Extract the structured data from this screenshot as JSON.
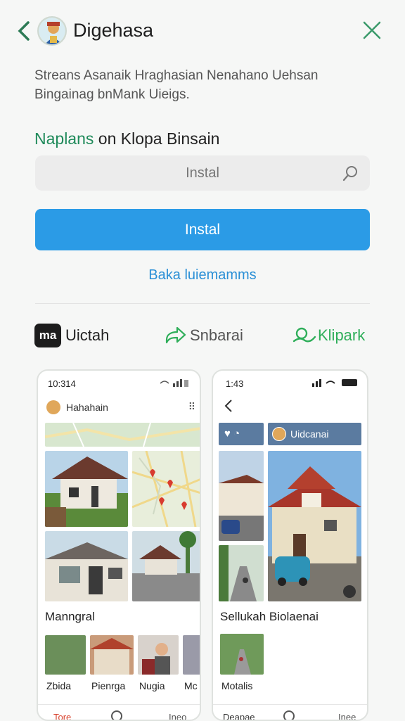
{
  "header": {
    "title": "Digehasa",
    "back_icon": "chevron-left-icon",
    "close_icon": "close-icon"
  },
  "description": "Streans Asanaik Hraghasian Nenahano Uehsan Bingainag bnMank Uieigs.",
  "section": {
    "title_green": "Naplans",
    "title_rest": "on Klopa Binsain"
  },
  "search": {
    "placeholder": "Instal"
  },
  "install_button": {
    "label": "Instal"
  },
  "secondary_link": {
    "label": "Baka luiemamms"
  },
  "share": [
    {
      "label": "Uictah",
      "icon": "app-logo-icon",
      "color": "#222222"
    },
    {
      "label": "Snbarai",
      "icon": "share-arrow-icon",
      "color": "#555555"
    },
    {
      "label": "Klipark",
      "icon": "link-icon",
      "color": "#2fae5a"
    }
  ],
  "phone_left": {
    "time": "10:314",
    "profile_name": "Hahahain",
    "section_label": "Manngral",
    "thumbs": [
      "Zbida",
      "Pienrga",
      "Nugia",
      "Mc"
    ],
    "nav_items": [
      "Tore",
      "",
      "Ineo"
    ]
  },
  "phone_right": {
    "time": "1:43",
    "header_label": "Uidcanai",
    "caption": "Sellukah Biolaenai",
    "thumb_label": "Motalis",
    "nav_items": [
      "Deapae",
      "",
      "Inee"
    ]
  }
}
